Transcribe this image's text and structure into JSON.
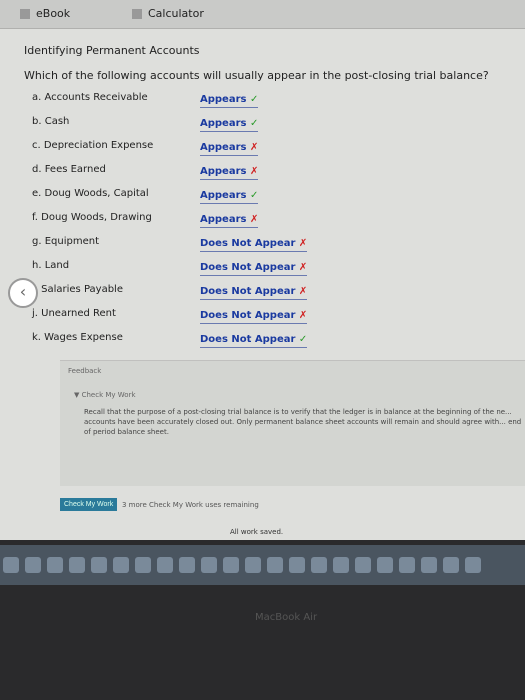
{
  "tabs": [
    "eBook",
    "Calculator"
  ],
  "title": "Identifying Permanent Accounts",
  "question": "Which of the following accounts will usually appear in the post-closing trial balance?",
  "items": [
    {
      "label": "a. Accounts Receivable",
      "answer": "Appears",
      "mark": "✓",
      "correct": true
    },
    {
      "label": "b. Cash",
      "answer": "Appears",
      "mark": "✓",
      "correct": true
    },
    {
      "label": "c. Depreciation Expense",
      "answer": "Appears",
      "mark": "✗",
      "correct": false
    },
    {
      "label": "d. Fees Earned",
      "answer": "Appears",
      "mark": "✗",
      "correct": false
    },
    {
      "label": "e. Doug Woods, Capital",
      "answer": "Appears",
      "mark": "✓",
      "correct": true
    },
    {
      "label": "f. Doug Woods, Drawing",
      "answer": "Appears",
      "mark": "✗",
      "correct": false
    },
    {
      "label": "g. Equipment",
      "answer": "Does Not Appear",
      "mark": "✗",
      "correct": false
    },
    {
      "label": "h. Land",
      "answer": "Does Not Appear",
      "mark": "✗",
      "correct": false
    },
    {
      "label": "i. Salaries Payable",
      "answer": "Does Not Appear",
      "mark": "✗",
      "correct": false
    },
    {
      "label": "j. Unearned Rent",
      "answer": "Does Not Appear",
      "mark": "✗",
      "correct": false
    },
    {
      "label": "k. Wages Expense",
      "answer": "Does Not Appear",
      "mark": "✓",
      "correct": true
    }
  ],
  "feedback": {
    "title": "Feedback",
    "section": "▼ Check My Work",
    "text": "Recall that the purpose of a post-closing trial balance is to verify that the ledger is in balance at the beginning of the ne... accounts have been accurately closed out. Only permanent balance sheet accounts will remain and should agree with... end of period balance sheet."
  },
  "check_button": "Check My Work",
  "remaining": "3 more Check My Work uses remaining",
  "saved": "All work saved.",
  "bezel": "MacBook Air",
  "colors": {
    "correct": "#2a9a2a",
    "incorrect": "#d02020",
    "answer": "#1a3aa0"
  }
}
